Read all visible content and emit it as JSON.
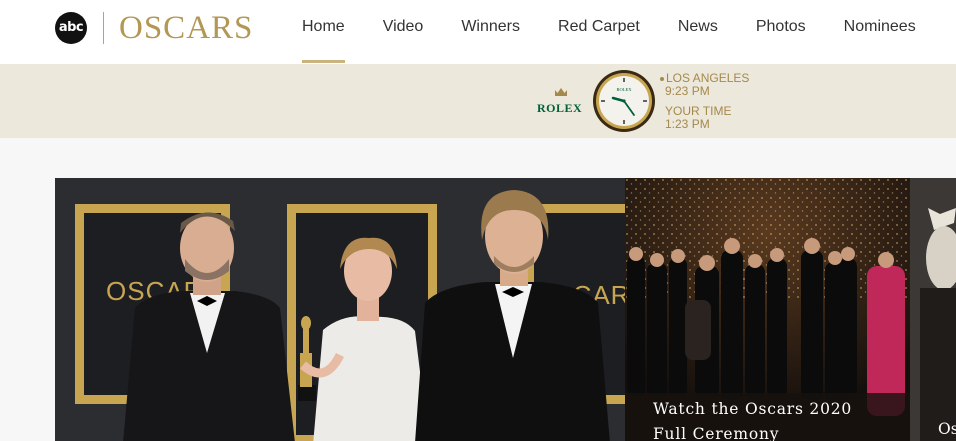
{
  "header": {
    "abc_logo": "abc",
    "brand": "OSCARS",
    "nav": [
      {
        "label": "Home",
        "active": true
      },
      {
        "label": "Video",
        "active": false
      },
      {
        "label": "Winners",
        "active": false
      },
      {
        "label": "Red Carpet",
        "active": false
      },
      {
        "label": "News",
        "active": false
      },
      {
        "label": "Photos",
        "active": false
      },
      {
        "label": "Nominees",
        "active": false
      }
    ]
  },
  "rolex": {
    "brand": "ROLEX",
    "dial_text": "ROLEX",
    "la_label": "LOS ANGELES",
    "la_time": "9:23 PM",
    "your_label": "YOUR TIME",
    "your_time": "1:23 PM"
  },
  "hero": {
    "backdrop_text": [
      "OSCARS",
      "OSCARS"
    ]
  },
  "cards": [
    {
      "title_line1": "Watch the Oscars 2020",
      "title_line2": "Full Ceremony"
    },
    {
      "title": "Os"
    }
  ],
  "colors": {
    "gold": "#b39755",
    "rolex_green": "#006039",
    "band": "#ece8dc",
    "nav_underline": "#c9b37e"
  }
}
